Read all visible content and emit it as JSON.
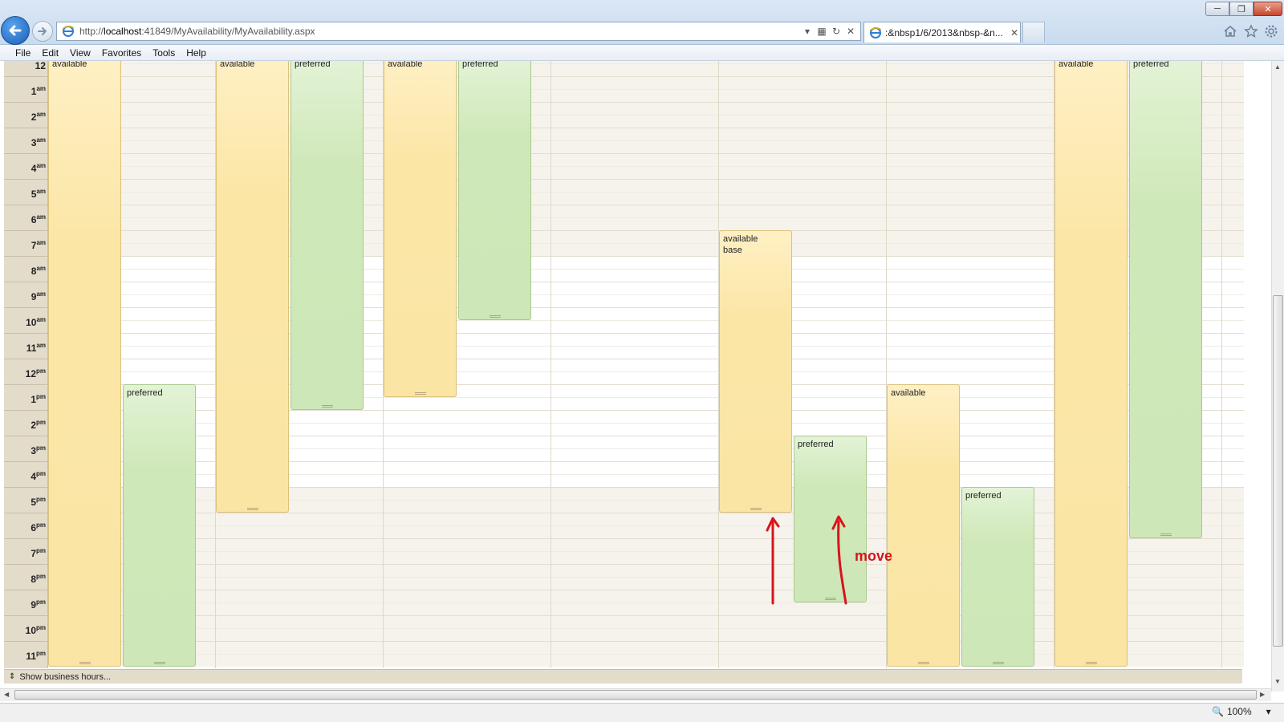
{
  "browser": {
    "url_prefix": "http://",
    "url_host": "localhost",
    "url_path": ":41849/MyAvailability/MyAvailability.aspx",
    "tab_title": ":&nbsp1/6/2013&nbsp-&n...",
    "zoom": "100%"
  },
  "menu": [
    "File",
    "Edit",
    "View",
    "Favorites",
    "Tools",
    "Help"
  ],
  "scheduler": {
    "hours": [
      {
        "n": "12",
        "s": ""
      },
      {
        "n": "1",
        "s": "am"
      },
      {
        "n": "2",
        "s": "am"
      },
      {
        "n": "3",
        "s": "am"
      },
      {
        "n": "4",
        "s": "am"
      },
      {
        "n": "5",
        "s": "am"
      },
      {
        "n": "6",
        "s": "am"
      },
      {
        "n": "7",
        "s": "am"
      },
      {
        "n": "8",
        "s": "am"
      },
      {
        "n": "9",
        "s": "am"
      },
      {
        "n": "10",
        "s": "am"
      },
      {
        "n": "11",
        "s": "am"
      },
      {
        "n": "12",
        "s": "pm"
      },
      {
        "n": "1",
        "s": "pm"
      },
      {
        "n": "2",
        "s": "pm"
      },
      {
        "n": "3",
        "s": "pm"
      },
      {
        "n": "4",
        "s": "pm"
      },
      {
        "n": "5",
        "s": "pm"
      },
      {
        "n": "6",
        "s": "pm"
      },
      {
        "n": "7",
        "s": "pm"
      },
      {
        "n": "8",
        "s": "pm"
      },
      {
        "n": "9",
        "s": "pm"
      },
      {
        "n": "10",
        "s": "pm"
      },
      {
        "n": "11",
        "s": "pm"
      }
    ],
    "appointments": [
      {
        "day": 0,
        "slot": 0,
        "type": "yellow",
        "start": 0,
        "end": 24,
        "lines": [
          "available"
        ]
      },
      {
        "day": 0,
        "slot": 1,
        "type": "green",
        "start": 13,
        "end": 24,
        "lines": [
          "preferred"
        ]
      },
      {
        "day": 1,
        "slot": 0,
        "type": "yellow",
        "start": 0,
        "end": 18,
        "lines": [
          "available"
        ]
      },
      {
        "day": 1,
        "slot": 1,
        "type": "green",
        "start": 0,
        "end": 14,
        "lines": [
          "preferred"
        ]
      },
      {
        "day": 2,
        "slot": 0,
        "type": "yellow",
        "start": 0,
        "end": 13.5,
        "lines": [
          "available"
        ]
      },
      {
        "day": 2,
        "slot": 1,
        "type": "green",
        "start": 0,
        "end": 10.5,
        "lines": [
          "preferred"
        ]
      },
      {
        "day": 4,
        "slot": 0,
        "type": "yellow",
        "start": 7,
        "end": 18,
        "lines": [
          "available",
          "base"
        ]
      },
      {
        "day": 4,
        "slot": 1,
        "type": "green",
        "start": 15,
        "end": 21.5,
        "lines": [
          "preferred"
        ]
      },
      {
        "day": 5,
        "slot": 0,
        "type": "yellow",
        "start": 13,
        "end": 24,
        "lines": [
          "available"
        ]
      },
      {
        "day": 5,
        "slot": 1,
        "type": "green",
        "start": 17,
        "end": 24,
        "lines": [
          "preferred"
        ]
      },
      {
        "day": 6,
        "slot": 0,
        "type": "yellow",
        "start": 0,
        "end": 24,
        "lines": [
          "available"
        ]
      },
      {
        "day": 6,
        "slot": 1,
        "type": "green",
        "start": 0,
        "end": 19,
        "lines": [
          "preferred"
        ]
      }
    ],
    "show_business_hours": "Show business hours...",
    "annotation_text": "move"
  }
}
